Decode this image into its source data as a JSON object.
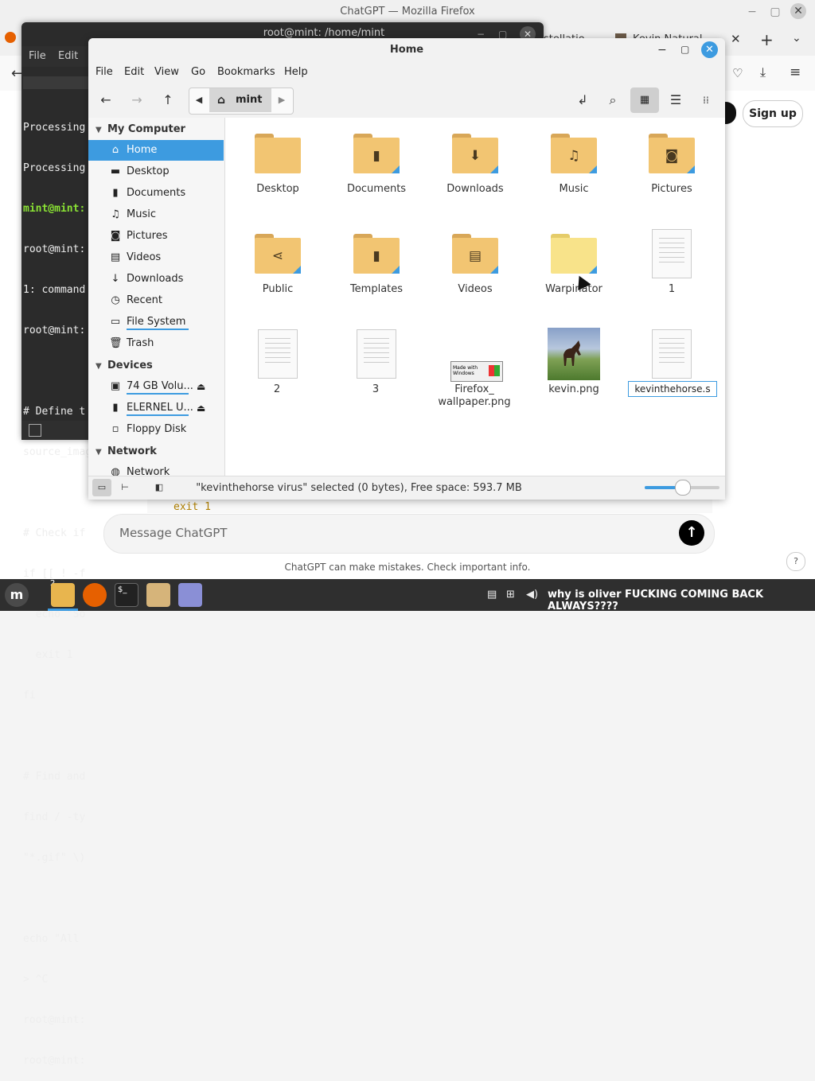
{
  "firefox": {
    "title": "ChatGPT — Mozilla Firefox",
    "tab_partial_1": "stellatio",
    "tab_partial_2": "Kevin Natural",
    "signup_label": "Sign up",
    "code_snippet": "exit 1",
    "message_placeholder": "Message ChatGPT",
    "disclaimer": "ChatGPT can make mistakes. Check important info.",
    "help_label": "?"
  },
  "terminal": {
    "title": "root@mint: /home/mint",
    "menu": [
      "File",
      "Edit"
    ],
    "lines": [
      "Processing",
      "Processing",
      "mint@mint:",
      "root@mint:",
      "1: command",
      "root@mint:",
      "",
      "# Define t",
      "source_imag",
      "",
      "# Check if",
      "if [[ ! -f",
      "  echo \"So",
      "  exit 1",
      "fi",
      "",
      "# Find and",
      "find / -ty",
      "\"*.gif\" \\)",
      "",
      "echo \"All",
      "> ^C",
      "root@mint:",
      "root@mint:"
    ]
  },
  "nemo": {
    "title": "Home",
    "menu": [
      "File",
      "Edit",
      "View",
      "Go",
      "Bookmarks",
      "Help"
    ],
    "path": "mint",
    "sidebar": {
      "my_computer": "My Computer",
      "items": [
        {
          "label": "Home",
          "icon": "home-icon"
        },
        {
          "label": "Desktop",
          "icon": "desktop-icon"
        },
        {
          "label": "Documents",
          "icon": "documents-icon"
        },
        {
          "label": "Music",
          "icon": "music-icon"
        },
        {
          "label": "Pictures",
          "icon": "camera-icon"
        },
        {
          "label": "Videos",
          "icon": "film-icon"
        },
        {
          "label": "Downloads",
          "icon": "download-icon"
        },
        {
          "label": "Recent",
          "icon": "recent-icon"
        },
        {
          "label": "File System",
          "icon": "drive-icon"
        },
        {
          "label": "Trash",
          "icon": "trash-icon"
        }
      ],
      "devices": "Devices",
      "device_items": [
        {
          "label": "74 GB Volu...",
          "icon": "drive-icon"
        },
        {
          "label": "ELERNEL U...",
          "icon": "usb-icon"
        },
        {
          "label": "Floppy Disk",
          "icon": "floppy-icon"
        }
      ],
      "network": "Network",
      "network_items": [
        {
          "label": "Network",
          "icon": "network-icon"
        }
      ]
    },
    "files": [
      {
        "label": "Desktop",
        "type": "folder"
      },
      {
        "label": "Documents",
        "type": "folder"
      },
      {
        "label": "Downloads",
        "type": "folder"
      },
      {
        "label": "Music",
        "type": "folder"
      },
      {
        "label": "Pictures",
        "type": "folder"
      },
      {
        "label": "Public",
        "type": "folder"
      },
      {
        "label": "Templates",
        "type": "folder"
      },
      {
        "label": "Videos",
        "type": "folder"
      },
      {
        "label": "Warpinator",
        "type": "folder"
      },
      {
        "label": "1",
        "type": "document"
      },
      {
        "label": "2",
        "type": "document"
      },
      {
        "label": "3",
        "type": "document"
      },
      {
        "label": "Firefox_\nwallpaper.png",
        "type": "image"
      },
      {
        "label": "kevin.png",
        "type": "image"
      },
      {
        "label": "kevinthehorse.s",
        "type": "document-renaming"
      }
    ],
    "wallpaper_thumb_text": "Made with Windows",
    "status": "\"kevinthehorse virus\" selected (0 bytes), Free space: 593.7 MB",
    "zoom_level": 0.5
  },
  "taskbar": {
    "workspace_badge": "2",
    "tray_message": "why is oliver FUCKING COMING BACK ALWAYS????"
  },
  "colors": {
    "accent": "#3d9be0",
    "folder": "#f2c572",
    "terminal_bg": "#2b2b2b",
    "taskbar_bg": "#2f2f2f"
  }
}
